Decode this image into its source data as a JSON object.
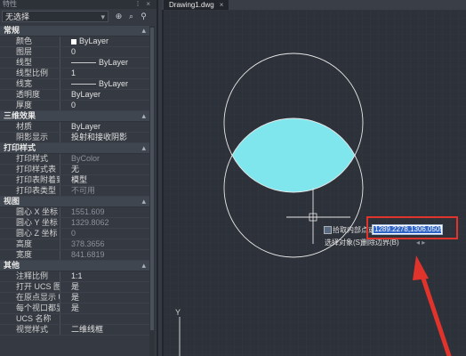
{
  "palette": {
    "title": "特性",
    "selection": "无选择",
    "sections": [
      {
        "title": "常规",
        "rows": [
          {
            "label": "颜色",
            "value": "ByLayer",
            "kind": "color"
          },
          {
            "label": "图层",
            "value": "0"
          },
          {
            "label": "线型",
            "value": "ByLayer",
            "kind": "linetype"
          },
          {
            "label": "线型比例",
            "value": "1"
          },
          {
            "label": "线宽",
            "value": "ByLayer",
            "kind": "linetype"
          },
          {
            "label": "透明度",
            "value": "ByLayer"
          },
          {
            "label": "厚度",
            "value": "0"
          }
        ]
      },
      {
        "title": "三维效果",
        "rows": [
          {
            "label": "材质",
            "value": "ByLayer"
          },
          {
            "label": "阴影显示",
            "value": "投射和接收阴影"
          }
        ]
      },
      {
        "title": "打印样式",
        "rows": [
          {
            "label": "打印样式",
            "value": "ByColor",
            "grey": true
          },
          {
            "label": "打印样式表",
            "value": "无"
          },
          {
            "label": "打印表附着到",
            "value": "模型"
          },
          {
            "label": "打印表类型",
            "value": "不可用",
            "grey": true
          }
        ]
      },
      {
        "title": "视图",
        "rows": [
          {
            "label": "圆心 X 坐标",
            "value": "1551.609",
            "grey": true
          },
          {
            "label": "圆心 Y 坐标",
            "value": "1329.8062",
            "grey": true
          },
          {
            "label": "圆心 Z 坐标",
            "value": "0",
            "grey": true
          },
          {
            "label": "高度",
            "value": "378.3656",
            "grey": true
          },
          {
            "label": "宽度",
            "value": "841.6819",
            "grey": true
          }
        ]
      },
      {
        "title": "其他",
        "rows": [
          {
            "label": "注释比例",
            "value": "1:1"
          },
          {
            "label": "打开 UCS 图标",
            "value": "是"
          },
          {
            "label": "在原点显示 UCS ...",
            "value": "是"
          },
          {
            "label": "每个视口都显示 UCS",
            "value": "是"
          },
          {
            "label": "UCS 名称",
            "value": ""
          },
          {
            "label": "视觉样式",
            "value": "二维线框"
          }
        ]
      }
    ]
  },
  "document": {
    "tab_label": "Drawing1.dwg",
    "tab_close": "×"
  },
  "drawing": {
    "fill_color": "#7fe6ee",
    "line_color": "#e8e8e8",
    "background": "#2d3139",
    "grid_color": "#363b44"
  },
  "context_menu": {
    "pick_point": "拾取内部点或",
    "select_objects": "选择对象(S)",
    "remove_boundary": "删除边界(B)",
    "coord_value": "1289.2278,1306.0505"
  },
  "annotation": {
    "arrow_color": "#e0332c"
  },
  "ucs_label": "Y"
}
